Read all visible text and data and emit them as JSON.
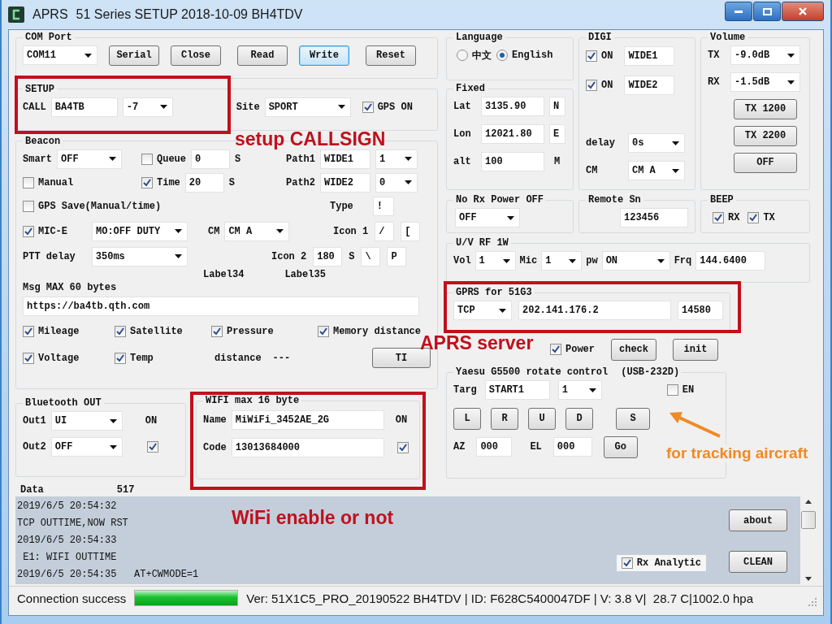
{
  "window": {
    "app_name": "APRS",
    "title": "51 Series SETUP 2018-10-09 BH4TDV"
  },
  "com_port": {
    "title": "COM Port",
    "port": "COM11",
    "buttons": [
      {
        "label": "Serial",
        "focused": false
      },
      {
        "label": "Close",
        "focused": false
      },
      {
        "label": "Read",
        "focused": false
      },
      {
        "label": "Write",
        "focused": true
      },
      {
        "label": "Reset",
        "focused": false
      }
    ]
  },
  "setup": {
    "title": "SETUP",
    "call_label": "CALL",
    "call": "BA4TB",
    "ssid": "-7",
    "site_label": "Site",
    "site": "SPORT",
    "gps_on": {
      "label": "GPS ON",
      "checked": true
    }
  },
  "beacon": {
    "title": "Beacon",
    "smart_label": "Smart",
    "smart": "OFF",
    "queue": {
      "label": "Queue",
      "checked": false
    },
    "queue_value": "0",
    "queue_unit": "S",
    "path1_label": "Path1",
    "path1": "WIDE1",
    "path1_n": "1",
    "manual": {
      "label": "Manual",
      "checked": false
    },
    "time": {
      "label": "Time",
      "checked": true
    },
    "time_value": "20",
    "time_unit": "S",
    "path2_label": "Path2",
    "path2": "WIDE2",
    "path2_n": "0",
    "gps_save": {
      "label": "GPS Save(Manual/time)",
      "checked": false
    },
    "type_label": "Type",
    "type": "!",
    "mic_e": {
      "label": "MIC-E",
      "checked": true
    },
    "mic_e_mode": "MO:OFF DUTY",
    "cm_label": "CM",
    "cm": "CM A",
    "icon1_label": "Icon 1",
    "icon1": [
      "/",
      "["
    ],
    "ptt_label": "PTT delay",
    "ptt": "350ms",
    "icon2_label": "Icon 2",
    "icon2_interval": "180",
    "icon2_unit": "S",
    "icon2": [
      "\\",
      "P"
    ],
    "extra_labels": [
      "Label34",
      "Label35"
    ],
    "msg_label": "Msg MAX 60 bytes",
    "msg": "https://ba4tb.qth.com",
    "options": [
      {
        "label": "Mileage",
        "checked": true
      },
      {
        "label": "Satellite",
        "checked": true
      },
      {
        "label": "Pressure",
        "checked": true
      },
      {
        "label": "Memory distance",
        "checked": true
      },
      {
        "label": "Voltage",
        "checked": true
      },
      {
        "label": "Temp",
        "checked": true
      }
    ],
    "distance_label": "distance",
    "distance": "---",
    "ti_button": "TI"
  },
  "bluetooth": {
    "title": "Bluetooth OUT",
    "out1_label": "Out1",
    "out1": "UI",
    "on_label": "ON",
    "out2_label": "Out2",
    "out2": "OFF",
    "enabled": true
  },
  "wifi": {
    "title": "WIFI max 16 byte",
    "name_label": "Name",
    "name": "MiWiFi_3452AE_2G",
    "on_label": "ON",
    "code_label": "Code",
    "code": "13013684000",
    "enabled": true
  },
  "data": {
    "label": "Data",
    "value": "517"
  },
  "log": {
    "lines": [
      "2019/6/5 20:54:32",
      "TCP OUTTIME,NOW RST",
      "2019/6/5 20:54:33",
      " E1: WIFI OUTTIME",
      "2019/6/5 20:54:35   AT+CWMODE=1"
    ],
    "rx_analytic": {
      "label": "Rx Analytic",
      "checked": true
    },
    "buttons": [
      "about",
      "CLEAN"
    ]
  },
  "status_bar": {
    "message": "Connection success",
    "progress": {
      "level": 1
    },
    "info": "Ver: 51X1C5_PRO_20190522 BH4TDV | ID: F628C5400047DF | V: 3.8 V|  28.7 C|1002.0 hpa"
  },
  "language": {
    "title": "Language",
    "options": [
      {
        "label": "中文",
        "selected": false
      },
      {
        "label": "English",
        "selected": true
      }
    ]
  },
  "fixed": {
    "title": "Fixed",
    "rows": [
      {
        "label": "Lat",
        "value": "3135.90",
        "unit": "N",
        "kind": "field"
      },
      {
        "label": "Lon",
        "value": "12021.80",
        "unit": "E",
        "kind": "field"
      },
      {
        "label": "alt",
        "value": "100",
        "unit": "M",
        "kind": "label"
      }
    ]
  },
  "digi": {
    "title": "DIGI",
    "paths": [
      {
        "label": "ON",
        "checked": true,
        "value": "WIDE1"
      },
      {
        "label": "ON",
        "checked": true,
        "value": "WIDE2"
      }
    ],
    "delay_label": "delay",
    "delay": "0s",
    "cm_label": "CM",
    "cm": "CM A"
  },
  "volume": {
    "title": "Volume",
    "rows": [
      {
        "label": "TX",
        "value": "-9.0dB"
      },
      {
        "label": "RX",
        "value": "-1.5dB"
      }
    ],
    "buttons": [
      "TX 1200",
      "TX 2200",
      "OFF"
    ]
  },
  "no_rx_power_off": {
    "title": "No Rx Power OFF",
    "value": "OFF"
  },
  "remote_sn": {
    "title": "Remote Sn",
    "value": "123456"
  },
  "beep": {
    "title": "BEEP",
    "options": [
      {
        "label": "RX",
        "checked": true
      },
      {
        "label": "TX",
        "checked": true
      }
    ]
  },
  "rf": {
    "title": "U/V RF 1W",
    "vol_label": "Vol",
    "vol": "1",
    "mic_label": "Mic",
    "mic": "1",
    "pw_label": "pw",
    "pw": "ON",
    "frq_label": "Frq",
    "frq": "144.6400"
  },
  "gprs": {
    "title": "GPRS for 51G3",
    "protocol": "TCP",
    "host": "202.141.176.2",
    "port": "14580",
    "power": {
      "label": "Power",
      "checked": true
    },
    "buttons": [
      "check",
      "init"
    ]
  },
  "rotator": {
    "title": "Yaesu G5500 rotate control",
    "note": "(USB-232D)",
    "targ_label": "Targ",
    "targ": "START1",
    "targ_n": "1",
    "enable": {
      "label": "EN",
      "checked": false
    },
    "buttons": [
      "L",
      "R",
      "U",
      "D",
      "S"
    ],
    "az_label": "AZ",
    "az": "000",
    "el_label": "EL",
    "el": "000",
    "go_button": "Go"
  },
  "annotations": [
    {
      "text": "setup CALLSIGN",
      "color": "#c0101c"
    },
    {
      "text": "APRS server",
      "color": "#c0101c"
    },
    {
      "text": "WiFi enable or not",
      "color": "#c0101c"
    },
    {
      "text": "for tracking aircraft",
      "color": "#f08a24"
    }
  ]
}
